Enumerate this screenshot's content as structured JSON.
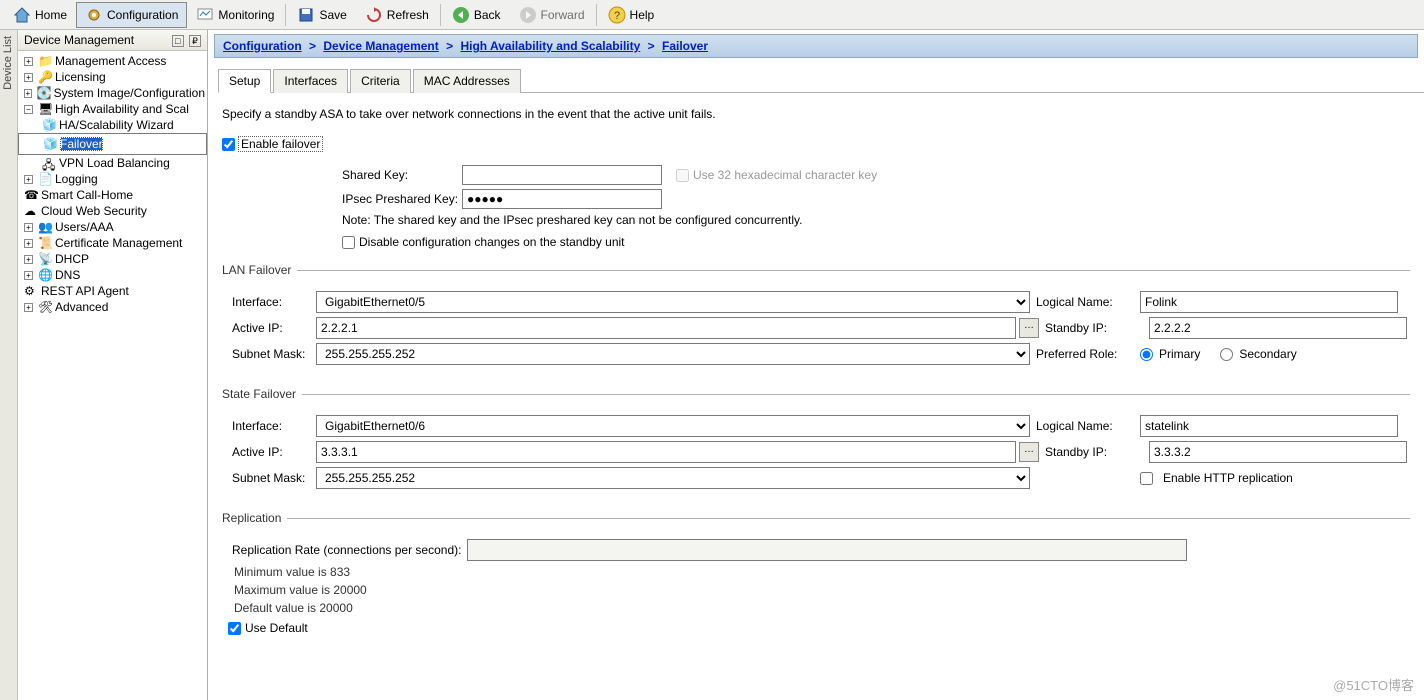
{
  "toolbar": {
    "home": "Home",
    "configuration": "Configuration",
    "monitoring": "Monitoring",
    "save": "Save",
    "refresh": "Refresh",
    "back": "Back",
    "forward": "Forward",
    "help": "Help"
  },
  "side_tab": "Device List",
  "sidebar": {
    "title": "Device Management",
    "items": [
      {
        "label": "Management Access"
      },
      {
        "label": "Licensing"
      },
      {
        "label": "System Image/Configuration"
      },
      {
        "label": "High Availability and Scal"
      },
      {
        "label": "HA/Scalability Wizard"
      },
      {
        "label": "Failover"
      },
      {
        "label": "VPN Load Balancing"
      },
      {
        "label": "Logging"
      },
      {
        "label": "Smart Call-Home"
      },
      {
        "label": "Cloud Web Security"
      },
      {
        "label": "Users/AAA"
      },
      {
        "label": "Certificate Management"
      },
      {
        "label": "DHCP"
      },
      {
        "label": "DNS"
      },
      {
        "label": "REST API Agent"
      },
      {
        "label": "Advanced"
      }
    ]
  },
  "breadcrumb": {
    "p1": "Configuration",
    "p2": "Device Management",
    "p3": "High Availability and Scalability",
    "p4": "Failover",
    "sep": ">"
  },
  "tabs": [
    "Setup",
    "Interfaces",
    "Criteria",
    "MAC Addresses"
  ],
  "content": {
    "desc": "Specify a standby ASA to take over network connections in the event that the active unit fails.",
    "enable_failover": "Enable failover",
    "shared_key_lbl": "Shared Key:",
    "use_hex": "Use 32 hexadecimal character key",
    "ipsec_lbl": "IPsec Preshared Key:",
    "ipsec_val": "●●●●●",
    "note": "Note: The shared key and the IPsec preshared key can not be configured concurrently.",
    "disable_cfg": "Disable configuration changes on the standby unit",
    "lan_title": "LAN Failover",
    "state_title": "State Failover",
    "repl_title": "Replication",
    "interface_lbl": "Interface:",
    "active_ip_lbl": "Active IP:",
    "subnet_lbl": "Subnet Mask:",
    "logical_lbl": "Logical Name:",
    "standby_ip_lbl": "Standby IP:",
    "preferred_lbl": "Preferred Role:",
    "primary": "Primary",
    "secondary": "Secondary",
    "http_repl": "Enable HTTP replication",
    "lan": {
      "interface": "GigabitEthernet0/5",
      "active_ip": "2.2.2.1",
      "subnet": "255.255.255.252",
      "logical": "Folink",
      "standby_ip": "2.2.2.2"
    },
    "state": {
      "interface": "GigabitEthernet0/6",
      "active_ip": "3.3.3.1",
      "subnet": "255.255.255.252",
      "logical": "statelink",
      "standby_ip": "3.3.3.2"
    },
    "repl_rate_lbl": "Replication Rate (connections per second):",
    "min_txt": "Minimum value is 833",
    "max_txt": "Maximum value is 20000",
    "def_txt": "Default value is 20000",
    "use_default": "Use Default"
  },
  "watermark": "@51CTO博客"
}
